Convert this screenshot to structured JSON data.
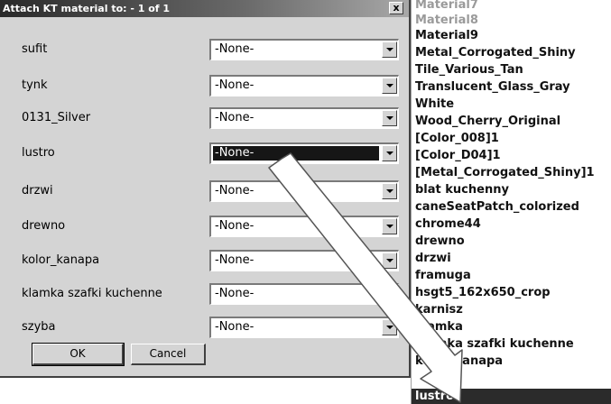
{
  "dialog": {
    "title": "Attach KT material to: - 1 of 1",
    "close_label": "x",
    "rows": [
      {
        "label": "sufit",
        "value": "-None-"
      },
      {
        "label": "tynk",
        "value": "-None-"
      },
      {
        "label": "0131_Silver",
        "value": "-None-"
      },
      {
        "label": "lustro",
        "value": "-None-",
        "selected": true
      },
      {
        "label": "drzwi",
        "value": "-None-"
      },
      {
        "label": "drewno",
        "value": "-None-"
      },
      {
        "label": "kolor_kanapa",
        "value": "-None-"
      },
      {
        "label": "klamka szafki kuchenne",
        "value": "-None-"
      },
      {
        "label": "szyba",
        "value": "-None-"
      }
    ],
    "ok_label": "OK",
    "cancel_label": "Cancel"
  },
  "material_list": {
    "items": [
      "Material7",
      "Material8",
      "Material9",
      "Metal_Corrogated_Shiny",
      "Tile_Various_Tan",
      "Translucent_Glass_Gray",
      "White",
      "Wood_Cherry_Original",
      "[Color_008]1",
      "[Color_D04]1",
      "[Metal_Corrogated_Shiny]1",
      "blat kuchenny",
      "caneSeatPatch_colorized",
      "chrome44",
      "drewno",
      "drzwi",
      "framuga",
      "hsgt5_162x650_crop",
      "karnisz",
      "klamka",
      "klamka szafki kuchenne",
      "kolor_kanapa",
      "lustro"
    ],
    "highlighted": "lustro"
  },
  "colors": {
    "highlight_bg": "#2b2b2b",
    "dialog_bg": "#d4d4d4",
    "arrow_fill": "#ffffff",
    "arrow_stroke": "#555555"
  }
}
